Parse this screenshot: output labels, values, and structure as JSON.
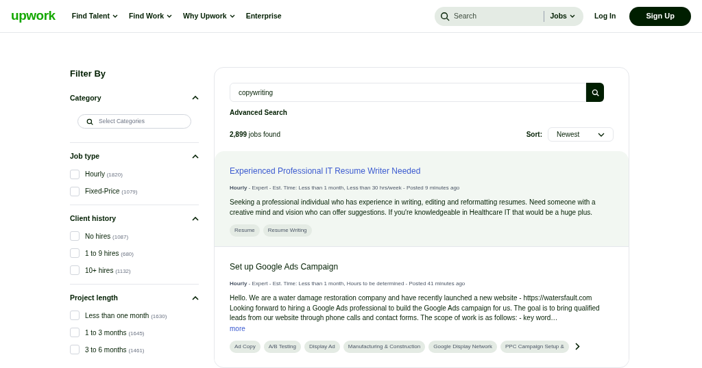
{
  "header": {
    "logo": "upwork",
    "nav": [
      {
        "label": "Find Talent",
        "dropdown": true
      },
      {
        "label": "Find Work",
        "dropdown": true
      },
      {
        "label": "Why Upwork",
        "dropdown": true
      },
      {
        "label": "Enterprise",
        "dropdown": false
      }
    ],
    "search": {
      "placeholder": "Search",
      "scope": "Jobs"
    },
    "login": "Log In",
    "signup": "Sign Up"
  },
  "filters": {
    "title": "Filter By",
    "sections": [
      {
        "title": "Category",
        "expanded": true,
        "kind": "search",
        "placeholder": "Select Categories"
      },
      {
        "title": "Job type",
        "expanded": true,
        "kind": "checks",
        "options": [
          {
            "label": "Hourly",
            "count": "(1820)",
            "checked": false
          },
          {
            "label": "Fixed-Price",
            "count": "(1079)",
            "checked": false
          }
        ]
      },
      {
        "title": "Client history",
        "expanded": true,
        "kind": "checks",
        "options": [
          {
            "label": "No hires",
            "count": "(1087)",
            "checked": false
          },
          {
            "label": "1 to 9 hires",
            "count": "(680)",
            "checked": false
          },
          {
            "label": "10+ hires",
            "count": "(1132)",
            "checked": false
          }
        ]
      },
      {
        "title": "Project length",
        "expanded": true,
        "kind": "checks",
        "options": [
          {
            "label": "Less than one month",
            "count": "(1630)",
            "checked": false
          },
          {
            "label": "1 to 3 months",
            "count": "(1645)",
            "checked": false
          },
          {
            "label": "3 to 6 months",
            "count": "(1461)",
            "checked": false
          }
        ]
      }
    ]
  },
  "results": {
    "query": "copywriting",
    "advanced": "Advanced Search",
    "count": "**2,899** jobs found",
    "sort_label": "Sort:",
    "sort_value": "Newest",
    "jobs": [
      {
        "title": "Experienced Professional IT Resume Writer Needed",
        "selected": true,
        "meta": "**Hourly** - Expert - Est. Time: Less than 1 month, Less than 30 hrs/week - Posted 9 minutes ago",
        "description": "Seeking a professional individual who has experience in writing, editing and reformatting resumes. Need someone with a creative mind and vision who can offer suggestions. If you're knowledgeable in Healthcare IT that would be a huge plus.",
        "tags": [
          "Resume",
          "Resume Writing"
        ]
      },
      {
        "title": "Set up Google Ads Campaign",
        "selected": false,
        "meta": "**Hourly** - Expert - Est. Time: Less than 1 month, Hours to be determined - Posted 41 minutes ago",
        "description": "Hello. We are a water damage restoration company and have recently launched a new website - https://watersfault.com Looking forward to hiring a Google Ads professional to build the Google Ads campaign for us. The goal is to bring qualified leads from our website through phone calls and contact forms. The scope of work is as follows: - key word…",
        "more": "more",
        "tags": [
          "Ad Copy",
          "A/B Testing",
          "Display Ad",
          "Manufacturing & Construction",
          "Google Display Network",
          "PPC Campaign Setup &"
        ]
      }
    ]
  }
}
